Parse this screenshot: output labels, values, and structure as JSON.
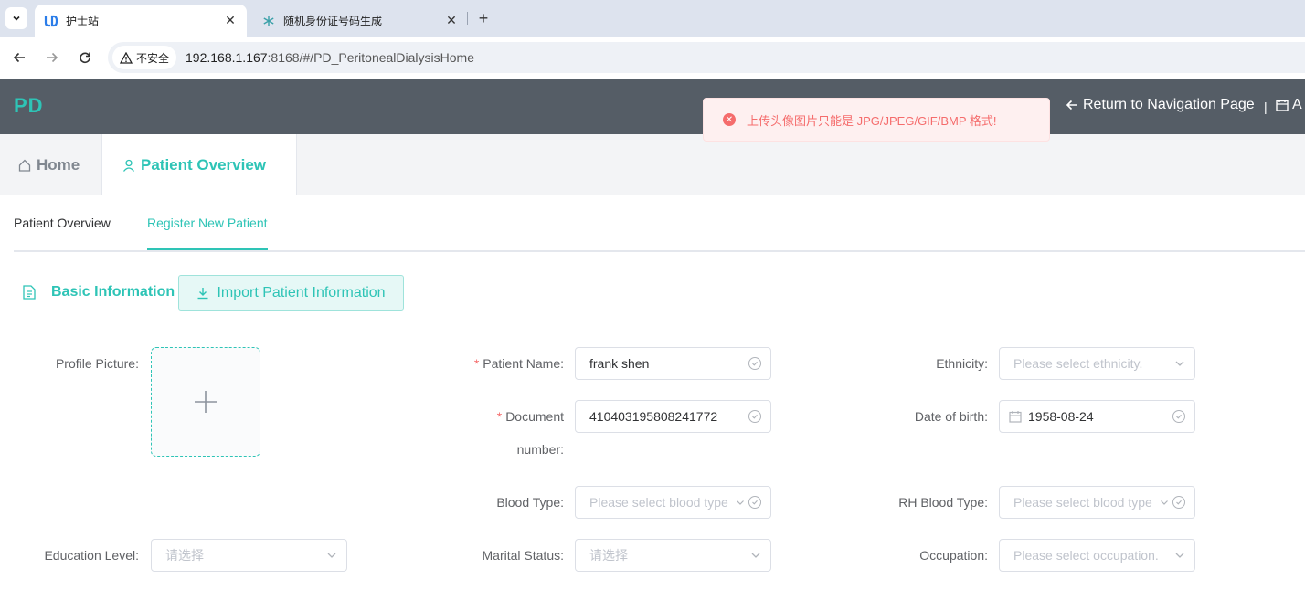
{
  "browser": {
    "tabs": [
      {
        "title": "护士站",
        "active": true
      },
      {
        "title": "随机身份证号码生成",
        "active": false
      }
    ],
    "security_label": "不安全",
    "url_host": "192.168.1.167",
    "url_rest": ":8168/#/PD_PeritonealDialysisHome"
  },
  "header": {
    "logo": "PD",
    "return_link": "Return to Navigation Page",
    "separator": "|",
    "extra_link": "A"
  },
  "toast": {
    "message": "上传头像图片只能是 JPG/JPEG/GIF/BMP 格式!"
  },
  "main_tabs": {
    "home": "Home",
    "overview": "Patient Overview"
  },
  "sub_tabs": {
    "overview": "Patient Overview",
    "register": "Register New Patient"
  },
  "section": {
    "title": "Basic Information",
    "import_button": "Import Patient Information"
  },
  "form": {
    "profile_picture_label": "Profile Picture:",
    "patient_name_label": "Patient Name:",
    "patient_name_value": "frank shen",
    "document_label_line1": "Document",
    "document_label_line2": "number:",
    "document_value": "410403195808241772",
    "ethnicity_label": "Ethnicity:",
    "ethnicity_placeholder": "Please select ethnicity.",
    "dob_label": "Date of birth:",
    "dob_value": "1958-08-24",
    "blood_type_label": "Blood Type:",
    "blood_type_placeholder": "Please select blood type",
    "rh_label": "RH Blood Type:",
    "rh_placeholder": "Please select blood type",
    "education_label": "Education Level:",
    "education_placeholder": "请选择",
    "marital_label": "Marital Status:",
    "marital_placeholder": "请选择",
    "occupation_label": "Occupation:",
    "occupation_placeholder": "Please select occupation."
  },
  "colors": {
    "accent": "#2ec4b6",
    "header_bg": "#555d66",
    "error": "#f56c6c"
  }
}
